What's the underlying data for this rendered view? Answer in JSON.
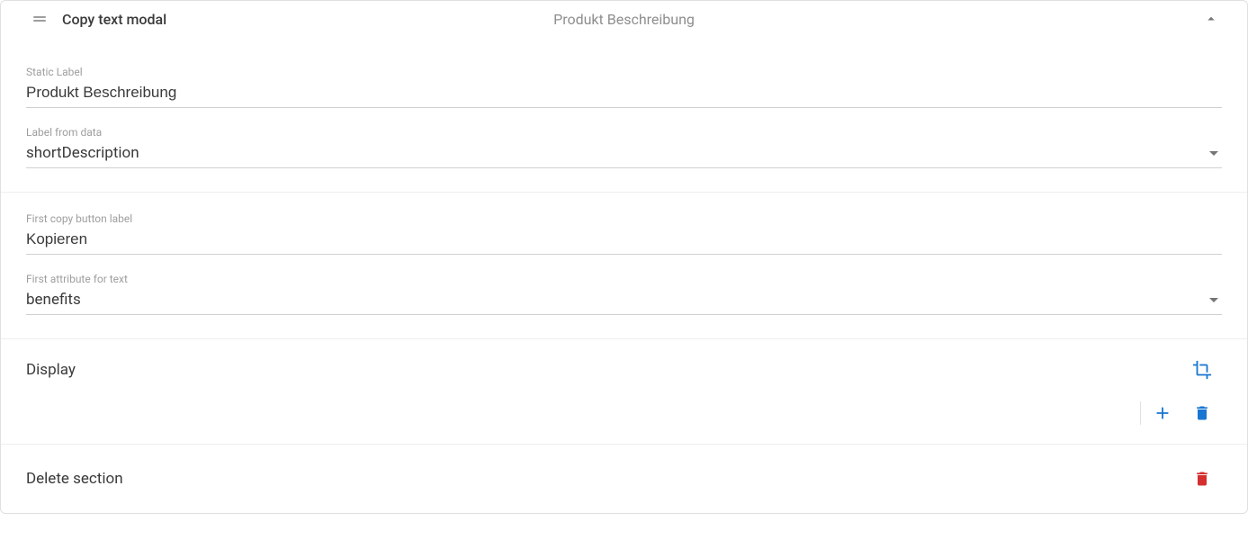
{
  "colors": {
    "accent": "#1976d2",
    "danger": "#d32f2f"
  },
  "header": {
    "title": "Copy text modal",
    "subtitle": "Produkt Beschreibung"
  },
  "fields": {
    "staticLabel": {
      "label": "Static Label",
      "value": "Produkt Beschreibung"
    },
    "labelFromData": {
      "label": "Label from data",
      "value": "shortDescription"
    },
    "firstCopyButtonLabel": {
      "label": "First copy button label",
      "value": "Kopieren"
    },
    "firstAttributeForText": {
      "label": "First attribute for text",
      "value": "benefits"
    }
  },
  "displaySection": {
    "label": "Display"
  },
  "deleteSection": {
    "label": "Delete section"
  }
}
